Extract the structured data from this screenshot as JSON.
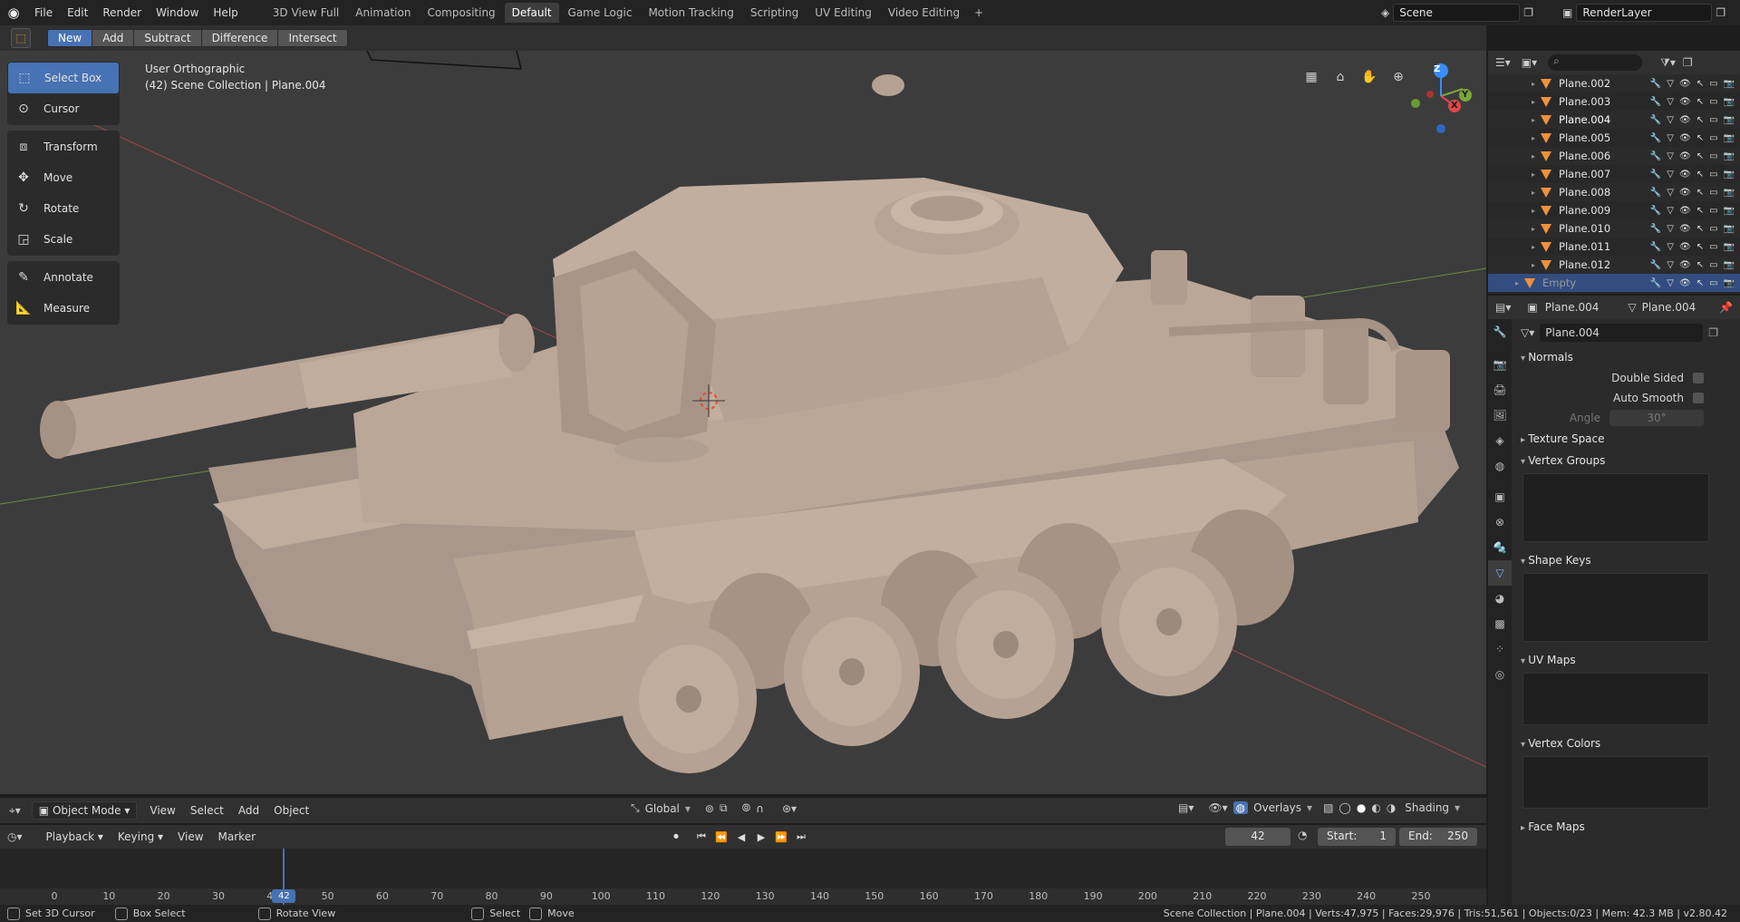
{
  "topbar": {
    "menus": [
      "File",
      "Edit",
      "Render",
      "Window",
      "Help"
    ],
    "workspaces": [
      "3D View Full",
      "Animation",
      "Compositing",
      "Default",
      "Game Logic",
      "Motion Tracking",
      "Scripting",
      "UV Editing",
      "Video Editing"
    ],
    "active_workspace": "Default",
    "add_tab": "+",
    "scene": "Scene",
    "render_layer": "RenderLayer"
  },
  "boolean_header": {
    "buttons": [
      "New",
      "Add",
      "Subtract",
      "Difference",
      "Intersect"
    ],
    "active": "New"
  },
  "viewport": {
    "view_name": "User Orthographic",
    "collection_info": "(42) Scene Collection | Plane.004",
    "gizmo_axes": [
      "Z",
      "Y",
      "X"
    ]
  },
  "toolbar": {
    "groups": [
      [
        {
          "label": "Select Box",
          "icon": "select-box-icon",
          "active": true
        },
        {
          "label": "Cursor",
          "icon": "cursor-icon"
        }
      ],
      [
        {
          "label": "Transform",
          "icon": "transform-icon"
        },
        {
          "label": "Move",
          "icon": "move-icon"
        },
        {
          "label": "Rotate",
          "icon": "rotate-icon"
        },
        {
          "label": "Scale",
          "icon": "scale-icon"
        }
      ],
      [
        {
          "label": "Annotate",
          "icon": "annotate-icon"
        },
        {
          "label": "Measure",
          "icon": "measure-icon"
        }
      ]
    ]
  },
  "viewport_header": {
    "mode": "Object Mode",
    "menus": [
      "View",
      "Select",
      "Add",
      "Object"
    ],
    "orientation": "Global",
    "overlays": "Overlays",
    "shading": "Shading"
  },
  "timeline": {
    "menus": [
      "Playback",
      "Keying",
      "View",
      "Marker"
    ],
    "current_frame": "42",
    "start_label": "Start:",
    "start": "1",
    "end_label": "End:",
    "end": "250",
    "ticks": [
      "0",
      "10",
      "20",
      "30",
      "40",
      "50",
      "60",
      "70",
      "80",
      "90",
      "100",
      "110",
      "120",
      "130",
      "140",
      "150",
      "160",
      "170",
      "180",
      "190",
      "200",
      "210",
      "220",
      "230",
      "240",
      "250"
    ],
    "playhead_label": "42"
  },
  "status": {
    "hints": [
      "Set 3D Cursor",
      "Box Select",
      "Rotate View",
      "Select",
      "Move"
    ],
    "stats": "Scene Collection | Plane.004 | Verts:47,975 | Faces:29,976 | Tris:51,561 | Objects:0/23 | Mem: 42.3 MB | v2.80.42"
  },
  "outliner": {
    "rows": [
      "Plane.002",
      "Plane.003",
      "Plane.004",
      "Plane.005",
      "Plane.006",
      "Plane.007",
      "Plane.008",
      "Plane.009",
      "Plane.010",
      "Plane.011",
      "Plane.012",
      "Empty"
    ],
    "selected": "Plane.004",
    "highlighted": "Empty"
  },
  "properties": {
    "object_name": "Plane.004",
    "mesh_name": "Plane.004",
    "data_field": "Plane.004",
    "panels": {
      "normals": "Normals",
      "double_sided": "Double Sided",
      "auto_smooth": "Auto Smooth",
      "angle_label": "Angle",
      "angle_value": "30°",
      "texture_space": "Texture Space",
      "vertex_groups": "Vertex Groups",
      "shape_keys": "Shape Keys",
      "uv_maps": "UV Maps",
      "vertex_colors": "Vertex Colors",
      "face_maps": "Face Maps"
    }
  },
  "colors": {
    "accent": "#4772b3",
    "object_orange": "#f0913b",
    "model": "#b8a596",
    "grid_red": "#b34a4a",
    "grid_green": "#7aa63c"
  }
}
